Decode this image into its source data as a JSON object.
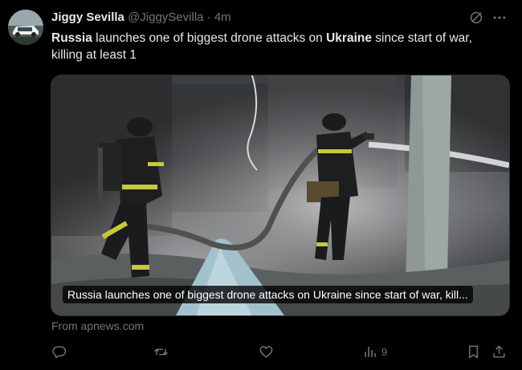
{
  "tweet": {
    "author_name": "Jiggy Sevilla",
    "handle": "@JiggySevilla",
    "separator": "·",
    "time": "4m",
    "text_parts": [
      {
        "bold": true,
        "text": "Russia"
      },
      {
        "bold": false,
        "text": " launches one of biggest drone attacks on "
      },
      {
        "bold": true,
        "text": "Ukraine"
      },
      {
        "bold": false,
        "text": " since start of war, killing at least 1"
      }
    ]
  },
  "card": {
    "caption": "Russia launches one of biggest drone attacks on Ukraine since start of war, kill...",
    "source": "From apnews.com"
  },
  "actions": {
    "reply_icon": "reply-icon",
    "retweet_icon": "retweet-icon",
    "like_icon": "heart-icon",
    "views_icon": "views-chart-icon",
    "views_count": "9",
    "bookmark_icon": "bookmark-icon",
    "share_icon": "share-icon"
  },
  "colors": {
    "background": "#000000",
    "text": "#e7e9ea",
    "muted": "#71767b",
    "border": "#2f3336"
  }
}
